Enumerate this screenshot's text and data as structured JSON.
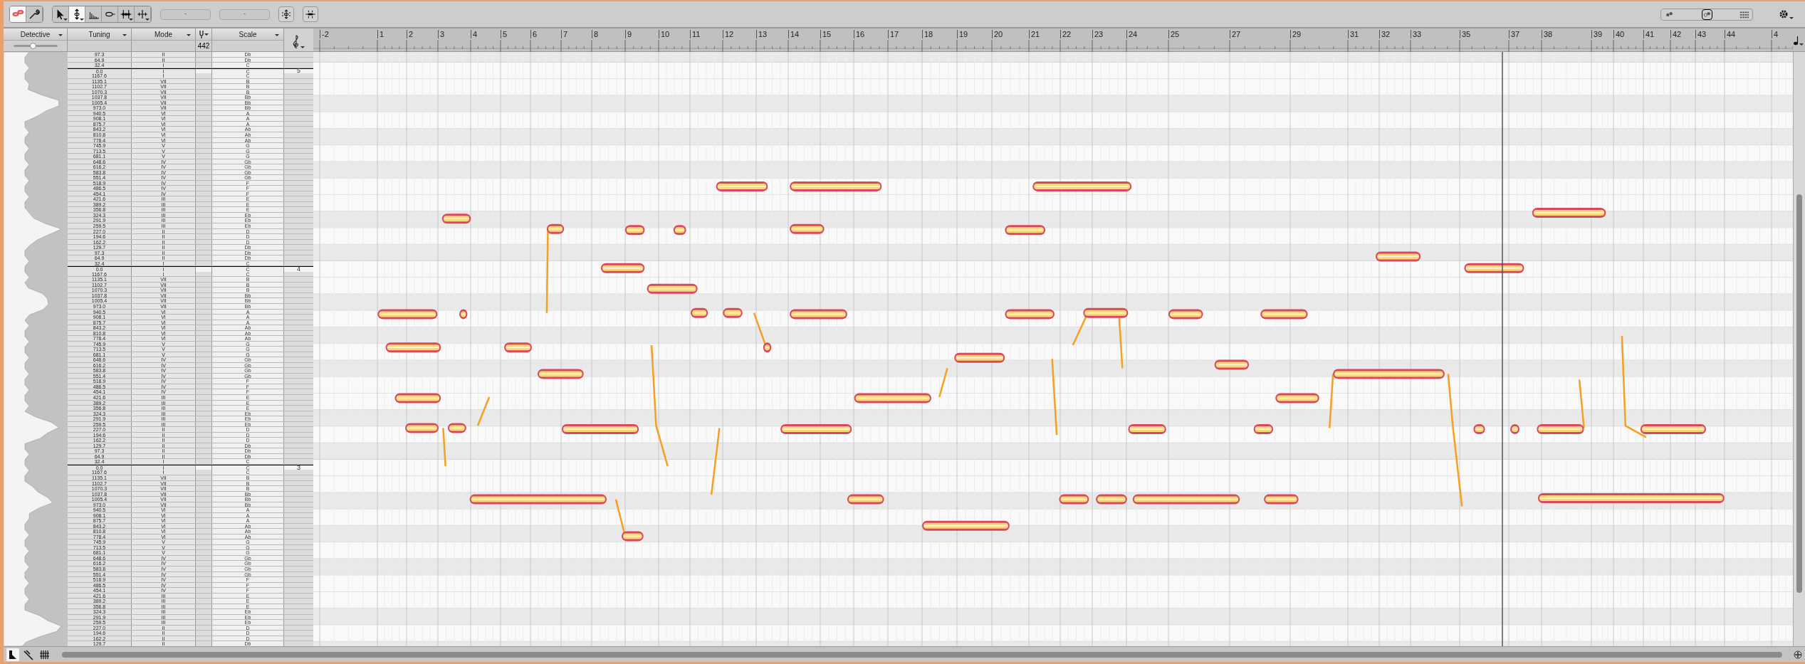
{
  "toolbar": {
    "groups": [
      [
        {
          "kind": "blobs",
          "selected": true,
          "menu": false
        },
        {
          "kind": "wrench",
          "selected": false,
          "menu": false
        }
      ],
      [
        {
          "kind": "arrow",
          "selected": false,
          "menu": true
        },
        {
          "kind": "pitch",
          "selected": true,
          "menu": true
        },
        {
          "kind": "formant",
          "selected": false,
          "menu": false
        },
        {
          "kind": "amplitude",
          "selected": false,
          "menu": false
        },
        {
          "kind": "timing",
          "selected": false,
          "menu": true
        },
        {
          "kind": "separate",
          "selected": false,
          "menu": true
        }
      ]
    ],
    "fields": [
      "-",
      "-"
    ],
    "buttons": [
      {
        "kind": "pitch-center"
      },
      {
        "kind": "quantize"
      }
    ],
    "view_modes": [
      {
        "kind": "blobs",
        "selected": false
      },
      {
        "kind": "blobs-pitch",
        "selected": true
      },
      {
        "kind": "notes",
        "selected": false
      }
    ]
  },
  "columns": [
    {
      "label": "Detective"
    },
    {
      "label": "Tuning"
    },
    {
      "label": "Mode"
    },
    {
      "label": "Scale"
    }
  ],
  "reference_pitch": "442",
  "detective_sensitivity": {
    "level": 0.45
  },
  "ruler": {
    "bars": [
      "-2",
      "1",
      "2",
      "3",
      "4",
      "5",
      "6",
      "7",
      "8",
      "9",
      "10",
      "11",
      "12",
      "13",
      "14",
      "15",
      "16",
      "17",
      "18",
      "19",
      "20",
      "21",
      "22",
      "23",
      "24",
      "25",
      "27",
      "29",
      "31",
      "32",
      "33",
      "35",
      "37",
      "38",
      "39",
      "40",
      "41",
      "42",
      "43",
      "44",
      "4"
    ]
  },
  "rows": [
    {
      "tuning": "97.3",
      "mode": "II",
      "scale": "Db"
    },
    {
      "tuning": "64.9",
      "mode": "II",
      "scale": "Db"
    },
    {
      "tuning": "32.4",
      "mode": "I",
      "scale": "C"
    },
    {
      "tuning": "0.0",
      "mode": "I",
      "scale": "C",
      "octave": "5"
    },
    {
      "tuning": "1167.6",
      "mode": "I",
      "scale": "C"
    },
    {
      "tuning": "1135.1",
      "mode": "VII",
      "scale": "B"
    },
    {
      "tuning": "1102.7",
      "mode": "VII",
      "scale": "B"
    },
    {
      "tuning": "1070.3",
      "mode": "VII",
      "scale": "B"
    },
    {
      "tuning": "1037.8",
      "mode": "VII",
      "scale": "Bb"
    },
    {
      "tuning": "1005.4",
      "mode": "VII",
      "scale": "Bb"
    },
    {
      "tuning": "973.0",
      "mode": "VII",
      "scale": "Bb"
    },
    {
      "tuning": "940.5",
      "mode": "VI",
      "scale": "A"
    },
    {
      "tuning": "908.1",
      "mode": "VI",
      "scale": "A"
    },
    {
      "tuning": "875.7",
      "mode": "VI",
      "scale": "A"
    },
    {
      "tuning": "843.2",
      "mode": "VI",
      "scale": "Ab"
    },
    {
      "tuning": "810.8",
      "mode": "VI",
      "scale": "Ab"
    },
    {
      "tuning": "778.4",
      "mode": "VI",
      "scale": "Ab"
    },
    {
      "tuning": "745.9",
      "mode": "V",
      "scale": "G"
    },
    {
      "tuning": "713.5",
      "mode": "V",
      "scale": "G"
    },
    {
      "tuning": "681.1",
      "mode": "V",
      "scale": "G"
    },
    {
      "tuning": "648.6",
      "mode": "IV",
      "scale": "Gb"
    },
    {
      "tuning": "616.2",
      "mode": "IV",
      "scale": "Gb"
    },
    {
      "tuning": "583.8",
      "mode": "IV",
      "scale": "Gb"
    },
    {
      "tuning": "551.4",
      "mode": "IV",
      "scale": "Gb"
    },
    {
      "tuning": "518.9",
      "mode": "IV",
      "scale": "F"
    },
    {
      "tuning": "486.5",
      "mode": "IV",
      "scale": "F"
    },
    {
      "tuning": "454.1",
      "mode": "IV",
      "scale": "F"
    },
    {
      "tuning": "421.6",
      "mode": "III",
      "scale": "E"
    },
    {
      "tuning": "389.2",
      "mode": "III",
      "scale": "E"
    },
    {
      "tuning": "356.8",
      "mode": "III",
      "scale": "E"
    },
    {
      "tuning": "324.3",
      "mode": "III",
      "scale": "Eb"
    },
    {
      "tuning": "291.9",
      "mode": "III",
      "scale": "Eb"
    },
    {
      "tuning": "259.5",
      "mode": "III",
      "scale": "Eb"
    },
    {
      "tuning": "227.0",
      "mode": "II",
      "scale": "D"
    },
    {
      "tuning": "194.6",
      "mode": "II",
      "scale": "D"
    },
    {
      "tuning": "162.2",
      "mode": "II",
      "scale": "D"
    },
    {
      "tuning": "129.7",
      "mode": "II",
      "scale": "Db"
    },
    {
      "tuning": "97.3",
      "mode": "II",
      "scale": "Db"
    },
    {
      "tuning": "64.9",
      "mode": "II",
      "scale": "Db"
    },
    {
      "tuning": "32.4",
      "mode": "I",
      "scale": "C"
    },
    {
      "tuning": "0.0",
      "mode": "I",
      "scale": "C",
      "octave": "4"
    },
    {
      "tuning": "1167.6",
      "mode": "I",
      "scale": "C"
    },
    {
      "tuning": "1135.1",
      "mode": "VII",
      "scale": "B"
    },
    {
      "tuning": "1102.7",
      "mode": "VII",
      "scale": "B"
    },
    {
      "tuning": "1070.3",
      "mode": "VII",
      "scale": "B"
    },
    {
      "tuning": "1037.8",
      "mode": "VII",
      "scale": "Bb"
    },
    {
      "tuning": "1005.4",
      "mode": "VII",
      "scale": "Bb"
    },
    {
      "tuning": "973.0",
      "mode": "VII",
      "scale": "Bb"
    },
    {
      "tuning": "940.5",
      "mode": "VI",
      "scale": "A"
    },
    {
      "tuning": "908.1",
      "mode": "VI",
      "scale": "A"
    },
    {
      "tuning": "875.7",
      "mode": "VI",
      "scale": "A"
    },
    {
      "tuning": "843.2",
      "mode": "VI",
      "scale": "Ab"
    },
    {
      "tuning": "810.8",
      "mode": "VI",
      "scale": "Ab"
    },
    {
      "tuning": "778.4",
      "mode": "VI",
      "scale": "Ab"
    },
    {
      "tuning": "745.9",
      "mode": "V",
      "scale": "G"
    },
    {
      "tuning": "713.5",
      "mode": "V",
      "scale": "G"
    },
    {
      "tuning": "681.1",
      "mode": "V",
      "scale": "G"
    },
    {
      "tuning": "648.6",
      "mode": "IV",
      "scale": "Gb"
    },
    {
      "tuning": "616.2",
      "mode": "IV",
      "scale": "Gb"
    },
    {
      "tuning": "583.8",
      "mode": "IV",
      "scale": "Gb"
    },
    {
      "tuning": "551.4",
      "mode": "IV",
      "scale": "Gb"
    },
    {
      "tuning": "518.9",
      "mode": "IV",
      "scale": "F"
    },
    {
      "tuning": "486.5",
      "mode": "IV",
      "scale": "F"
    },
    {
      "tuning": "454.1",
      "mode": "IV",
      "scale": "F"
    },
    {
      "tuning": "421.6",
      "mode": "III",
      "scale": "E"
    },
    {
      "tuning": "389.2",
      "mode": "III",
      "scale": "E"
    },
    {
      "tuning": "356.8",
      "mode": "III",
      "scale": "E"
    },
    {
      "tuning": "324.3",
      "mode": "III",
      "scale": "Eb"
    },
    {
      "tuning": "291.9",
      "mode": "III",
      "scale": "Eb"
    },
    {
      "tuning": "259.5",
      "mode": "III",
      "scale": "Eb"
    },
    {
      "tuning": "227.0",
      "mode": "II",
      "scale": "D"
    },
    {
      "tuning": "194.6",
      "mode": "II",
      "scale": "D"
    },
    {
      "tuning": "162.2",
      "mode": "II",
      "scale": "D"
    },
    {
      "tuning": "129.7",
      "mode": "II",
      "scale": "Db"
    },
    {
      "tuning": "97.3",
      "mode": "II",
      "scale": "Db"
    },
    {
      "tuning": "64.9",
      "mode": "II",
      "scale": "Db"
    },
    {
      "tuning": "32.4",
      "mode": "I",
      "scale": "C"
    },
    {
      "tuning": "0.0",
      "mode": "I",
      "scale": "C",
      "octave": "3"
    },
    {
      "tuning": "1167.6",
      "mode": "I",
      "scale": "C"
    },
    {
      "tuning": "1135.1",
      "mode": "VII",
      "scale": "B"
    },
    {
      "tuning": "1102.7",
      "mode": "VII",
      "scale": "B"
    },
    {
      "tuning": "1070.3",
      "mode": "VII",
      "scale": "B"
    },
    {
      "tuning": "1037.8",
      "mode": "VII",
      "scale": "Bb"
    },
    {
      "tuning": "1005.4",
      "mode": "VII",
      "scale": "Bb"
    },
    {
      "tuning": "973.0",
      "mode": "VII",
      "scale": "Bb"
    },
    {
      "tuning": "940.5",
      "mode": "VI",
      "scale": "A"
    },
    {
      "tuning": "908.1",
      "mode": "VI",
      "scale": "A"
    },
    {
      "tuning": "875.7",
      "mode": "VI",
      "scale": "A"
    },
    {
      "tuning": "843.2",
      "mode": "VI",
      "scale": "Ab"
    },
    {
      "tuning": "810.8",
      "mode": "VI",
      "scale": "Ab"
    },
    {
      "tuning": "778.4",
      "mode": "VI",
      "scale": "Ab"
    },
    {
      "tuning": "745.9",
      "mode": "V",
      "scale": "G"
    },
    {
      "tuning": "713.5",
      "mode": "V",
      "scale": "G"
    },
    {
      "tuning": "681.1",
      "mode": "V",
      "scale": "G"
    },
    {
      "tuning": "648.6",
      "mode": "IV",
      "scale": "Gb"
    },
    {
      "tuning": "616.2",
      "mode": "IV",
      "scale": "Gb"
    },
    {
      "tuning": "583.8",
      "mode": "IV",
      "scale": "Gb"
    },
    {
      "tuning": "551.4",
      "mode": "IV",
      "scale": "Gb"
    },
    {
      "tuning": "518.9",
      "mode": "IV",
      "scale": "F"
    },
    {
      "tuning": "486.5",
      "mode": "IV",
      "scale": "F"
    },
    {
      "tuning": "454.1",
      "mode": "IV",
      "scale": "F"
    },
    {
      "tuning": "421.6",
      "mode": "III",
      "scale": "E"
    },
    {
      "tuning": "389.2",
      "mode": "III",
      "scale": "E"
    },
    {
      "tuning": "356.8",
      "mode": "III",
      "scale": "E"
    },
    {
      "tuning": "324.3",
      "mode": "III",
      "scale": "Eb"
    },
    {
      "tuning": "291.9",
      "mode": "III",
      "scale": "Eb"
    },
    {
      "tuning": "259.5",
      "mode": "III",
      "scale": "Eb"
    },
    {
      "tuning": "227.0",
      "mode": "II",
      "scale": "D"
    },
    {
      "tuning": "194.6",
      "mode": "II",
      "scale": "D"
    },
    {
      "tuning": "162.2",
      "mode": "II",
      "scale": "D"
    },
    {
      "tuning": "129.7",
      "mode": "II",
      "scale": "Db"
    }
  ],
  "bottom_tools": [
    {
      "kind": "note",
      "selected": true
    },
    {
      "kind": "fork",
      "selected": false
    },
    {
      "kind": "sharps",
      "selected": false
    }
  ]
}
